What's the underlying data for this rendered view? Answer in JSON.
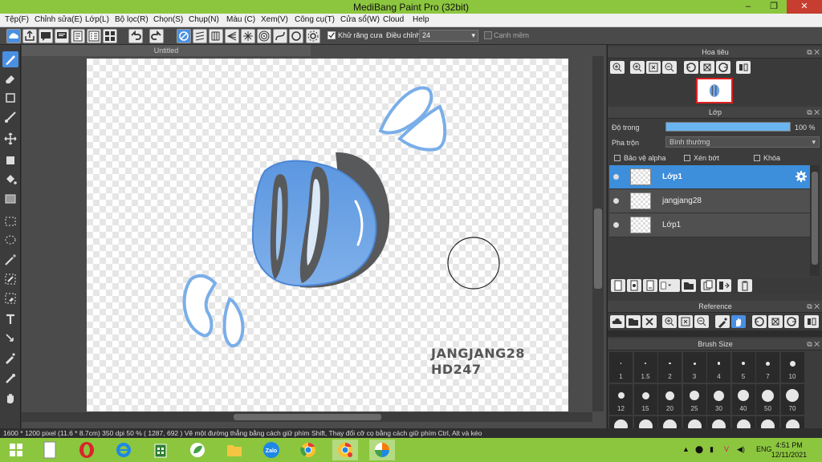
{
  "window": {
    "title": "MediBang Paint Pro (32bit)",
    "min": "–",
    "max": "❐",
    "close": "✕"
  },
  "menu": [
    "Tệp(F)",
    "Chỉnh sửa(E)",
    "Lớp(L)",
    "Bộ lọc(R)",
    "Chọn(S)",
    "Chụp(N)",
    "Màu (C)",
    "Xem(V)",
    "Công cụ(T)",
    "Cửa sổ(W)",
    "Cloud",
    "Help"
  ],
  "toolbar": {
    "antialias_label": "Khử răng cưa",
    "antialias_checked": true,
    "correction_label": "Điều chỉnh",
    "correction_value": "24",
    "edge_label": "Cạnh mềm",
    "edge_checked": false
  },
  "document": {
    "tab_title": "Untitled",
    "signature_line1": "JANGJANG28",
    "signature_line2": "HD247"
  },
  "navigator": {
    "title": "Hoa tiêu"
  },
  "layers": {
    "title": "Lớp",
    "opacity_label": "Độ trong",
    "opacity_value": "100 %",
    "opacity_fraction": 1.0,
    "blend_label": "Pha trộn",
    "blend_value": "Bình thường",
    "protect_alpha": "Bảo vệ alpha",
    "clipping": "Xén bớt",
    "lock": "Khóa",
    "items": [
      {
        "name": "Lớp1",
        "selected": true
      },
      {
        "name": "jangjang28",
        "selected": false
      },
      {
        "name": "Lớp1",
        "selected": false
      }
    ]
  },
  "reference": {
    "title": "Reference"
  },
  "brush_size": {
    "title": "Brush Size",
    "row1": [
      "1",
      "1.5",
      "2",
      "3",
      "4",
      "5",
      "7",
      "10"
    ],
    "row2": [
      "12",
      "15",
      "20",
      "25",
      "30",
      "40",
      "50",
      "70"
    ]
  },
  "status": {
    "text": "1600 * 1200 pixel   (11.6 * 8.7cm)   350 dpi   50 %   ( 1287, 692 )   Vẽ một đường thẳng bằng cách giữ phím Shift, Thay đổi cỡ cọ bằng cách giữ phím Ctrl, Alt và kéo"
  },
  "taskbar": {
    "lang": "ENG",
    "time": "4:51 PM",
    "date": "12/11/2021"
  },
  "colors": {
    "accent": "#8cc63f",
    "selection": "#3d8edb",
    "panel": "#3c3c3c"
  }
}
